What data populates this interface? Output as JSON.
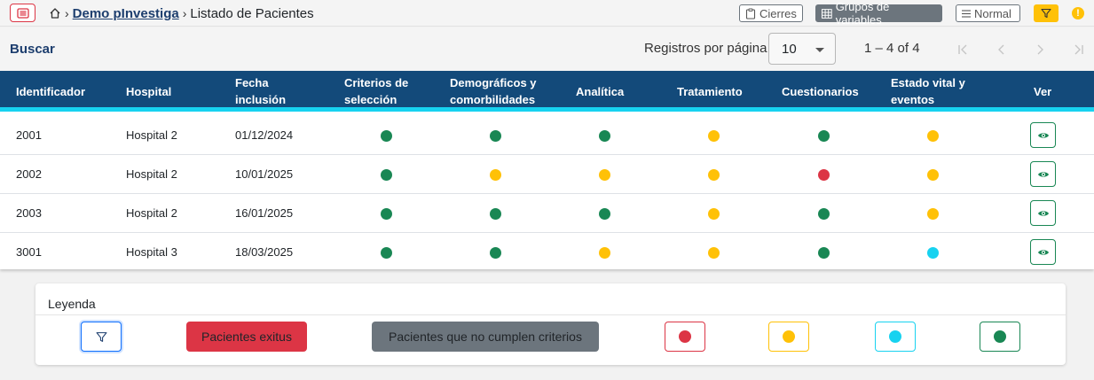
{
  "colors": {
    "header_bg": "#134a7a",
    "header_accent": "#17d2f0",
    "green": "#198754",
    "yellow": "#ffc107",
    "red": "#dc3545",
    "cyan": "#17d2f0",
    "grey": "#6c757d"
  },
  "topbar": {
    "menu_icon": "menu-icon",
    "home_icon": "home-icon",
    "breadcrumb_project": "Demo pInvestiga",
    "breadcrumb_current": "Listado de Pacientes",
    "cierres_label": "Cierres",
    "grupos_label": "Grupos de variables",
    "normal_label": "Normal",
    "filter_icon": "filter-icon",
    "info_icon": "info-icon",
    "info_glyph": "!"
  },
  "search": {
    "buscar_label": "Buscar",
    "rows_per_page_label": "Registros por página",
    "rows_per_page_value": "10",
    "range_label": "1 – 4 of 4"
  },
  "table": {
    "headers": [
      "Identificador",
      "Hospital",
      "Fecha\ninclusión",
      "Criterios de\nselección",
      "Demográficos y\ncomorbilidades",
      "Analítica",
      "Tratamiento",
      "Cuestionarios",
      "Estado vital y\neventos",
      "Ver"
    ],
    "rows": [
      {
        "id": "2001",
        "hospital": "Hospital 2",
        "fecha": "01/12/2024",
        "status": [
          "green",
          "green",
          "green",
          "yellow",
          "green",
          "yellow"
        ]
      },
      {
        "id": "2002",
        "hospital": "Hospital 2",
        "fecha": "10/01/2025",
        "status": [
          "green",
          "yellow",
          "yellow",
          "yellow",
          "red",
          "yellow"
        ]
      },
      {
        "id": "2003",
        "hospital": "Hospital 2",
        "fecha": "16/01/2025",
        "status": [
          "green",
          "green",
          "green",
          "yellow",
          "green",
          "yellow"
        ]
      },
      {
        "id": "3001",
        "hospital": "Hospital 3",
        "fecha": "18/03/2025",
        "status": [
          "green",
          "green",
          "yellow",
          "yellow",
          "green",
          "cyan"
        ]
      }
    ]
  },
  "legend": {
    "title": "Leyenda",
    "exitus_label": "Pacientes exitus",
    "no_criterios_label": "Pacientes que no cumplen criterios",
    "status_swatches": [
      "red",
      "yellow",
      "cyan",
      "green"
    ]
  }
}
